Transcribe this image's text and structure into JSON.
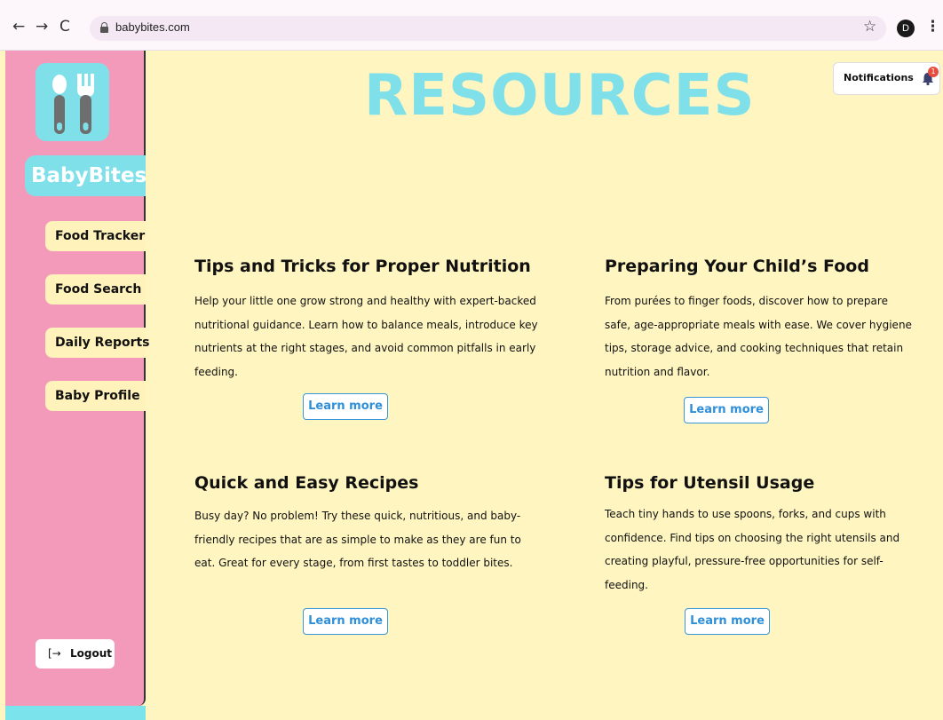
{
  "browser": {
    "url": "babybites.com",
    "profile_initial": "D",
    "nav_back": "←",
    "nav_forward": "→",
    "nav_reload": "C",
    "bookmark_glyph": "☆",
    "menu_glyph": "⋮"
  },
  "sidebar": {
    "brand": "BabyBites",
    "items": [
      {
        "label": "Food Tracker"
      },
      {
        "label": "Food Search"
      },
      {
        "label": "Daily Reports"
      },
      {
        "label": "Baby Profile"
      }
    ],
    "logout_label": "Logout",
    "logout_icon": "[→"
  },
  "header": {
    "title": "RESOURCES",
    "notifications_label": "Notifications",
    "notifications_count": "1"
  },
  "cards": [
    {
      "title": "Tips and Tricks for Proper Nutrition",
      "text": "Help your little one grow strong and healthy with expert-backed nutritional guidance. Learn how to balance meals, introduce key nutrients at the right stages, and avoid common pitfalls in early feeding.",
      "button": "Learn more"
    },
    {
      "title": "Preparing Your Child’s Food",
      "text": "From purées to finger foods, discover how to prepare safe, age-appropriate meals with ease. We cover hygiene tips, storage advice, and cooking techniques that retain nutrition and flavor.",
      "button": "Learn more"
    },
    {
      "title": "Quick and Easy Recipes",
      "text": "Busy day? No problem! Try these quick, nutritious, and baby-friendly recipes that are as simple to make as they are fun to eat. Great for every stage, from first tastes to toddler bites.",
      "button": "Learn more"
    },
    {
      "title": "Tips for Utensil Usage",
      "text": "Teach tiny hands to use spoons, forks, and cups with confidence. Find tips on choosing the right utensils and creating playful, pressure-free opportunities for self-feeding.",
      "button": "Learn more"
    }
  ],
  "colors": {
    "background": "#fff5c0",
    "sidebar": "#f399ba",
    "accent_cyan": "#7fe0ea",
    "button_blue": "#2f8fd8",
    "badge_red": "#e84c3d"
  }
}
